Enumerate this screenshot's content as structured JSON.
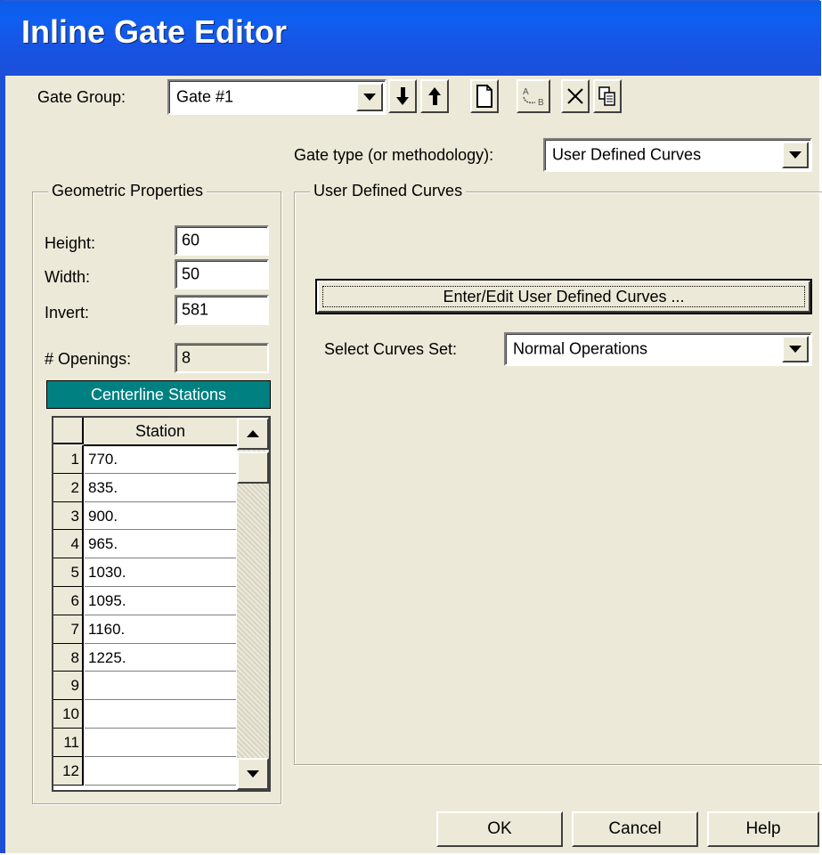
{
  "window": {
    "title": "Inline Gate Editor"
  },
  "gate_group": {
    "label": "Gate Group:",
    "value": "Gate #1"
  },
  "toolbar": {
    "icons": [
      "arrow-down-icon",
      "arrow-up-icon",
      "new-document-icon",
      "rename-icon",
      "delete-icon",
      "copy-icon"
    ]
  },
  "gate_type": {
    "label": "Gate type (or methodology):",
    "value": "User Defined Curves"
  },
  "geometric": {
    "title": "Geometric Properties",
    "height_label": "Height:",
    "height_value": "60",
    "width_label": "Width:",
    "width_value": "50",
    "invert_label": "Invert:",
    "invert_value": "581",
    "openings_label": "# Openings:",
    "openings_value": "8"
  },
  "stations": {
    "header": "Centerline Stations",
    "column": "Station",
    "rows": [
      {
        "n": "1",
        "v": "770."
      },
      {
        "n": "2",
        "v": "835."
      },
      {
        "n": "3",
        "v": "900."
      },
      {
        "n": "4",
        "v": "965."
      },
      {
        "n": "5",
        "v": "1030."
      },
      {
        "n": "6",
        "v": "1095."
      },
      {
        "n": "7",
        "v": "1160."
      },
      {
        "n": "8",
        "v": "1225."
      },
      {
        "n": "9",
        "v": ""
      },
      {
        "n": "10",
        "v": ""
      },
      {
        "n": "11",
        "v": ""
      },
      {
        "n": "12",
        "v": ""
      }
    ]
  },
  "curves": {
    "title": "User Defined Curves",
    "edit_button": "Enter/Edit User Defined Curves ...",
    "set_label": "Select Curves Set:",
    "set_value": "Normal Operations"
  },
  "buttons": {
    "ok": "OK",
    "cancel": "Cancel",
    "help": "Help"
  },
  "colors": {
    "title_bar": "#1b4fd8",
    "grid_header": "#008080",
    "dialog": "#ece9d8"
  }
}
